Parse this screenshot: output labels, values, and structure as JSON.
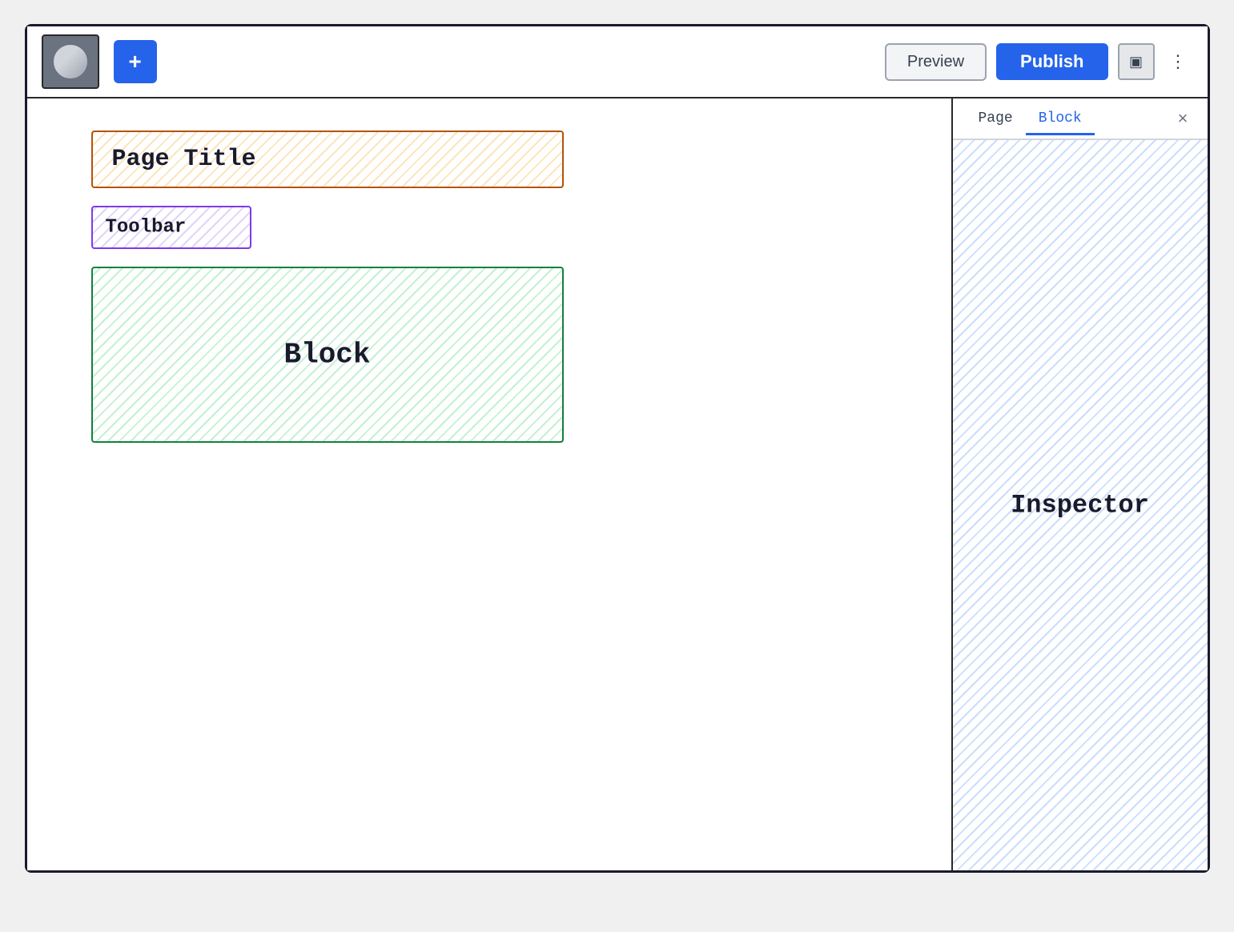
{
  "topbar": {
    "add_label": "+",
    "preview_label": "Preview",
    "publish_label": "Publish",
    "more_label": "⋮"
  },
  "inspector": {
    "tab_page_label": "Page",
    "tab_block_label": "Block",
    "close_label": "×",
    "body_label": "Inspector",
    "active_tab": "block"
  },
  "canvas": {
    "page_title_label": "Page Title",
    "toolbar_label": "Toolbar",
    "block_label": "Block"
  }
}
